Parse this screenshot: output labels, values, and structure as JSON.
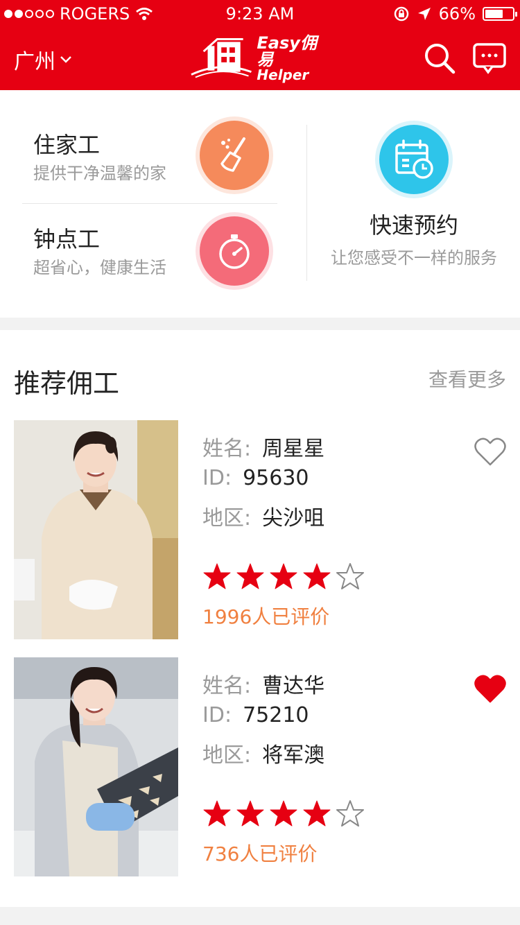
{
  "status_bar": {
    "carrier": "ROGERS",
    "time": "9:23 AM",
    "battery": "66%",
    "battery_level": 0.66
  },
  "nav": {
    "city": "广州",
    "logo_line1": "Easy佣易",
    "logo_line2": "Helper"
  },
  "services": {
    "live_in": {
      "title": "住家工",
      "subtitle": "提供干净温馨的家"
    },
    "hourly": {
      "title": "钟点工",
      "subtitle": "超省心，健康生活"
    },
    "quick": {
      "title": "快速预约",
      "subtitle": "让您感受不一样的服务"
    }
  },
  "colors": {
    "brand": "#e60012",
    "orange": "#f58a5b",
    "pink": "#f46b79",
    "cyan": "#2ec5ea",
    "review": "#f08040"
  },
  "recommend": {
    "title": "推荐佣工",
    "more": "查看更多",
    "workers": [
      {
        "name_label": "姓名:",
        "name": "周星星",
        "id_label": "ID:",
        "id": "95630",
        "area_label": "地区:",
        "area": "尖沙咀",
        "rating": 4,
        "rating_max": 5,
        "reviews": "1996人已评价",
        "favorited": false
      },
      {
        "name_label": "姓名:",
        "name": "曹达华",
        "id_label": "ID:",
        "id": "75210",
        "area_label": "地区:",
        "area": "将军澳",
        "rating": 4,
        "rating_max": 5,
        "reviews": "736人已评价",
        "favorited": true
      }
    ]
  }
}
